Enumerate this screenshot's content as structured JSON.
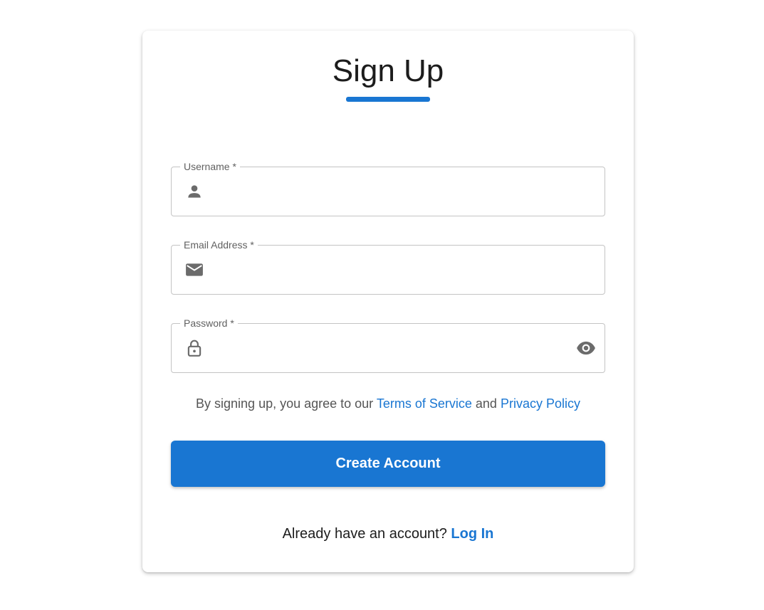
{
  "form": {
    "title": "Sign Up",
    "username": {
      "label": "Username *",
      "value": "",
      "icon": "person-icon"
    },
    "email": {
      "label": "Email Address *",
      "value": "",
      "icon": "email-icon"
    },
    "password": {
      "label": "Password *",
      "value": "",
      "icon": "lock-icon",
      "toggle_icon": "eye-icon"
    },
    "terms": {
      "prefix": "By signing up, you agree to our ",
      "terms_link": "Terms of Service",
      "joiner": " and ",
      "privacy_link": "Privacy Policy"
    },
    "submit_label": "Create Account",
    "login": {
      "prompt": "Already have an account? ",
      "link": "Log In"
    }
  },
  "colors": {
    "accent": "#1976d2",
    "icon": "#6b6b6b",
    "border": "#c4c4c4"
  }
}
